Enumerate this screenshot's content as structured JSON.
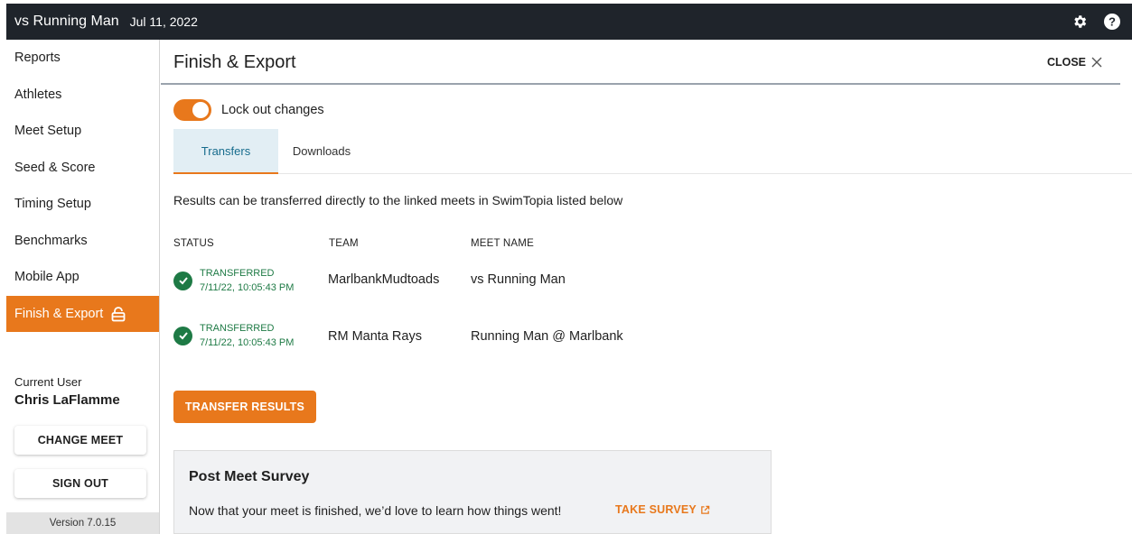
{
  "topbar": {
    "meet_name": "vs Running Man",
    "date": "Jul 11, 2022"
  },
  "sidebar": {
    "items": [
      {
        "label": "Reports"
      },
      {
        "label": "Athletes"
      },
      {
        "label": "Meet Setup"
      },
      {
        "label": "Seed & Score"
      },
      {
        "label": "Timing Setup"
      },
      {
        "label": "Benchmarks"
      },
      {
        "label": "Mobile App"
      },
      {
        "label": "Finish & Export",
        "active": true
      }
    ],
    "current_user_label": "Current User",
    "current_user_name": "Chris LaFlamme",
    "change_meet_label": "CHANGE MEET",
    "sign_out_label": "SIGN OUT",
    "version": "Version 7.0.15"
  },
  "page": {
    "title": "Finish & Export",
    "close_label": "CLOSE",
    "lock_toggle_label": "Lock out changes",
    "lock_toggle_on": true,
    "tabs": [
      {
        "label": "Transfers",
        "active": true
      },
      {
        "label": "Downloads",
        "active": false
      }
    ],
    "intro": "Results can be transferred directly to the linked meets in SwimTopia listed below",
    "table": {
      "headers": [
        "STATUS",
        "TEAM",
        "MEET NAME"
      ],
      "rows": [
        {
          "status": "TRANSFERRED",
          "timestamp": "7/11/22, 10:05:43 PM",
          "team": "MarlbankMudtoads",
          "meet_name": "vs Running Man"
        },
        {
          "status": "TRANSFERRED",
          "timestamp": "7/11/22, 10:05:43 PM",
          "team": "RM Manta Rays",
          "meet_name": "Running Man @ Marlbank"
        }
      ]
    },
    "transfer_button_label": "TRANSFER RESULTS",
    "survey": {
      "title": "Post Meet Survey",
      "text": "Now that your meet is finished, we’d love to learn how things went!",
      "link_label": "TAKE SURVEY"
    }
  },
  "colors": {
    "accent": "#e8781c",
    "topbar": "#1f242b",
    "success": "#1e7a45",
    "tab_active_bg": "#e2eef4",
    "tab_active_text": "#176c8d"
  }
}
